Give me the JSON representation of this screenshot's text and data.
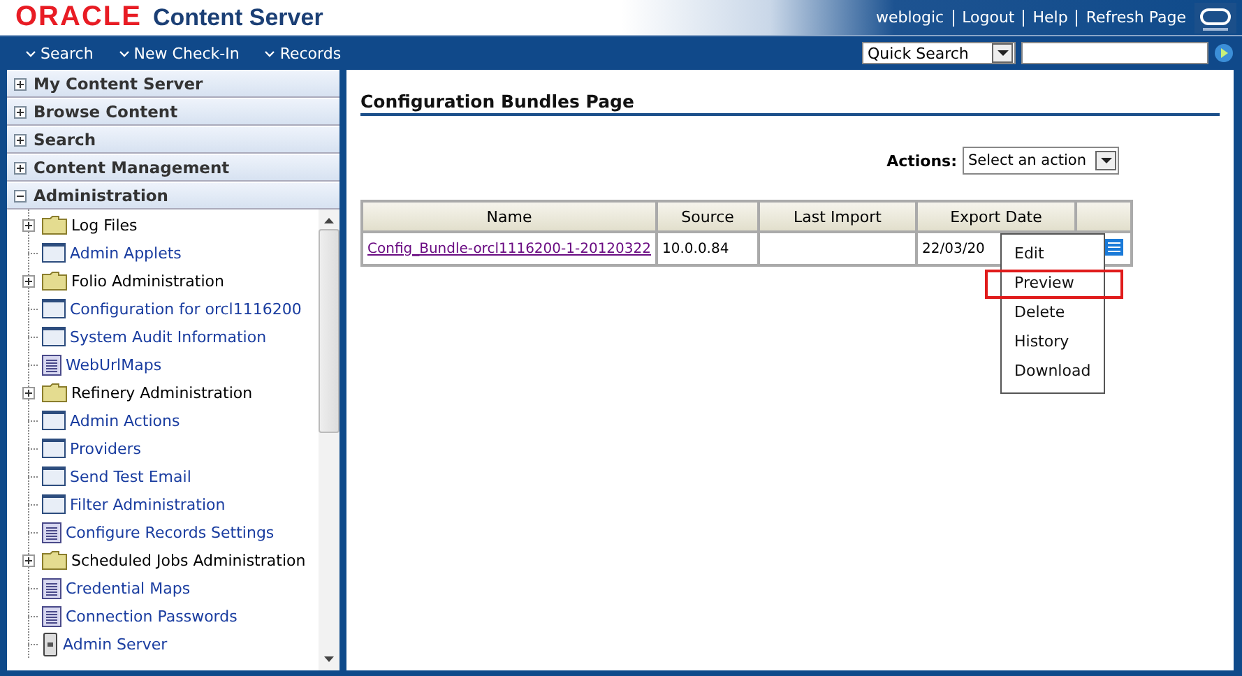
{
  "header": {
    "logo": "ORACLE",
    "product": "Content Server",
    "links": [
      "weblogic",
      "Logout",
      "Help",
      "Refresh Page"
    ]
  },
  "nav": {
    "menus": [
      "Search",
      "New Check-In",
      "Records"
    ],
    "quick_search": {
      "value": "Quick Search"
    }
  },
  "sidebar": {
    "sections": [
      {
        "label": "My Content Server",
        "expanded": false
      },
      {
        "label": "Browse Content",
        "expanded": false
      },
      {
        "label": "Search",
        "expanded": false
      },
      {
        "label": "Content Management",
        "expanded": false
      },
      {
        "label": "Administration",
        "expanded": true
      }
    ],
    "tree": [
      {
        "label": "Log Files",
        "kind": "folder"
      },
      {
        "label": "Admin Applets",
        "kind": "window"
      },
      {
        "label": "Folio Administration",
        "kind": "folder"
      },
      {
        "label": "Configuration for orcl1116200",
        "kind": "window"
      },
      {
        "label": "System Audit Information",
        "kind": "window"
      },
      {
        "label": "WebUrlMaps",
        "kind": "document"
      },
      {
        "label": "Refinery Administration",
        "kind": "folder"
      },
      {
        "label": "Admin Actions",
        "kind": "window"
      },
      {
        "label": "Providers",
        "kind": "window"
      },
      {
        "label": "Send Test Email",
        "kind": "window"
      },
      {
        "label": "Filter Administration",
        "kind": "window"
      },
      {
        "label": "Configure Records Settings",
        "kind": "document"
      },
      {
        "label": "Scheduled Jobs Administration",
        "kind": "folder"
      },
      {
        "label": "Credential Maps",
        "kind": "document"
      },
      {
        "label": "Connection Passwords",
        "kind": "document"
      },
      {
        "label": "Admin Server",
        "kind": "server"
      }
    ]
  },
  "content": {
    "title": "Configuration Bundles Page",
    "actions_label": "Actions:",
    "actions_select": "Select an action",
    "table": {
      "columns": [
        "Name",
        "Source",
        "Last Import",
        "Export Date"
      ],
      "rows": [
        {
          "name": "Config_Bundle-orcl1116200-1-20120322",
          "source": "10.0.0.84",
          "last_import": "",
          "export_date": "22/03/20"
        }
      ]
    },
    "menu": [
      {
        "label": "Edit",
        "highlighted": false
      },
      {
        "label": "Preview",
        "highlighted": true
      },
      {
        "label": "Delete",
        "highlighted": false
      },
      {
        "label": "History",
        "highlighted": false
      },
      {
        "label": "Download",
        "highlighted": false
      }
    ]
  }
}
